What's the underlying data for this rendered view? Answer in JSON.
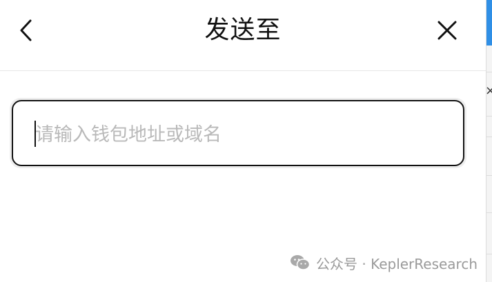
{
  "header": {
    "title": "发送至",
    "back_icon": "chevron-left-icon",
    "close_icon": "close-icon"
  },
  "address_input": {
    "value": "",
    "placeholder": "请输入钱包地址或域名"
  },
  "watermark": {
    "icon": "wechat-icon",
    "text": "公众号 · KeplerResearch"
  },
  "colors": {
    "border": "#111111",
    "placeholder": "#b9b9b9",
    "accent": "#2f8fe6"
  }
}
